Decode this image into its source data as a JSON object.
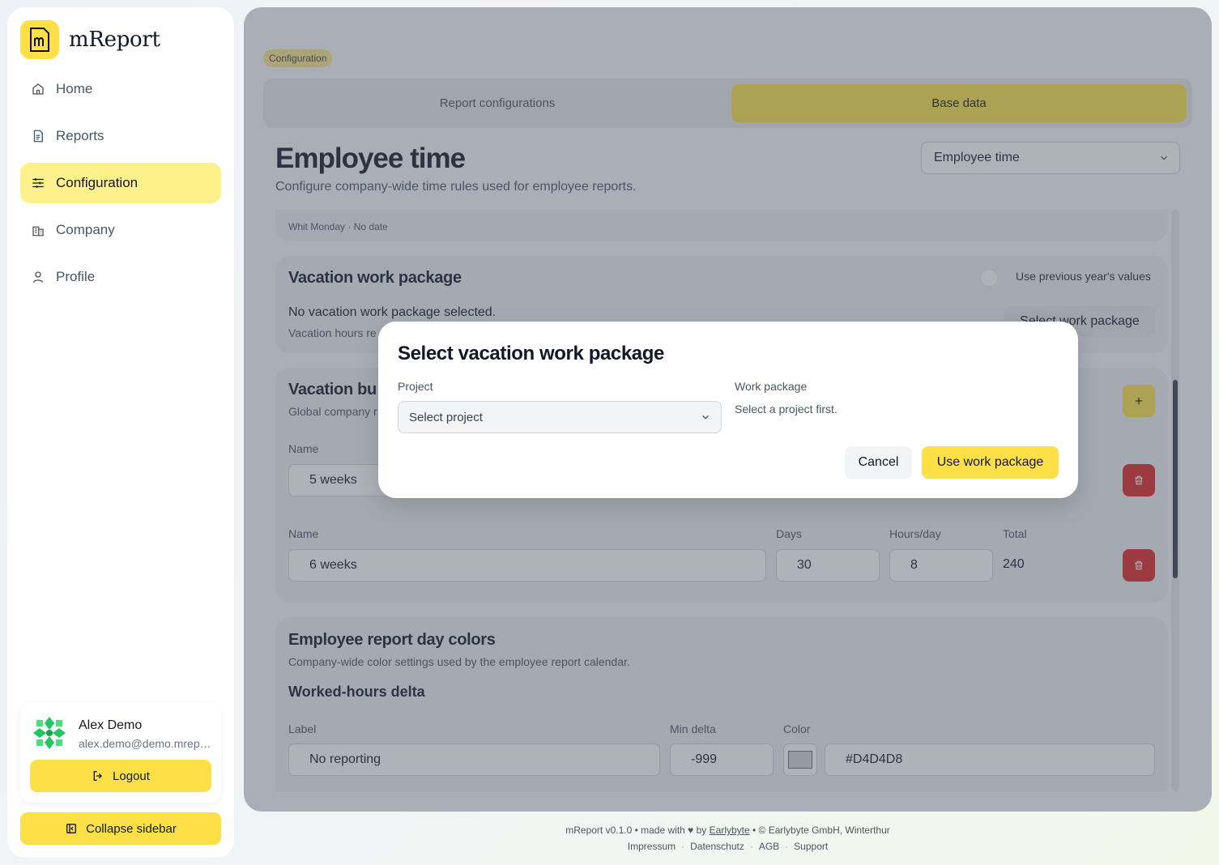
{
  "app": {
    "name": "mReport"
  },
  "sidebar": {
    "items": [
      {
        "label": "Home",
        "icon": "home-icon"
      },
      {
        "label": "Reports",
        "icon": "document-icon"
      },
      {
        "label": "Configuration",
        "icon": "sliders-icon",
        "active": true
      },
      {
        "label": "Company",
        "icon": "building-icon"
      },
      {
        "label": "Profile",
        "icon": "user-icon"
      }
    ],
    "user": {
      "name": "Alex Demo",
      "email": "alex.demo@demo.mreport.ch"
    },
    "logout_label": "Logout",
    "collapse_label": "Collapse sidebar"
  },
  "main": {
    "breadcrumb": "Configuration",
    "tabs": [
      {
        "label": "Report configurations",
        "active": false
      },
      {
        "label": "Base data",
        "active": true
      }
    ],
    "title": "Employee time",
    "subtitle": "Configure company-wide time rules used for employee reports.",
    "section_select": "Employee time",
    "holiday_line": "Whit Monday · No date",
    "vacation_wp": {
      "title": "Vacation work package",
      "toggle_label": "Use previous year's values",
      "empty": "No vacation work package selected.",
      "hint": "Vacation hours re",
      "select_btn": "Select work package"
    },
    "vacation_budgets": {
      "title": "Vacation bu",
      "desc": "Global company r",
      "labels": {
        "name": "Name",
        "days": "Days",
        "hours": "Hours/day",
        "total": "Total"
      },
      "rows": [
        {
          "name": "5 weeks"
        },
        {
          "name": "6 weeks",
          "days": "30",
          "hours": "8",
          "total": "240"
        }
      ]
    },
    "day_colors": {
      "title": "Employee report day colors",
      "desc": "Company-wide color settings used by the employee report calendar.",
      "subtitle": "Worked-hours delta",
      "labels": {
        "label": "Label",
        "min": "Min delta",
        "color": "Color"
      },
      "row": {
        "label": "No reporting",
        "min": "-999",
        "color": "#D4D4D8"
      }
    }
  },
  "modal": {
    "title": "Select vacation work package",
    "project_label": "Project",
    "project_placeholder": "Select project",
    "wp_label": "Work package",
    "wp_hint": "Select a project first.",
    "cancel": "Cancel",
    "confirm": "Use work package"
  },
  "footer": {
    "line_pre": "mReport v0.1.0 • made with ♥ by ",
    "link": "Earlybyte",
    "line_post": " • © Earlybyte GmbH, Winterthur",
    "links": [
      "Impressum",
      "Datenschutz",
      "AGB",
      "Support"
    ]
  },
  "colors": {
    "accent": "#FDE047",
    "accent_light": "#FEF08A",
    "danger": "#DC2626",
    "swatch": "#D4D4D8"
  }
}
